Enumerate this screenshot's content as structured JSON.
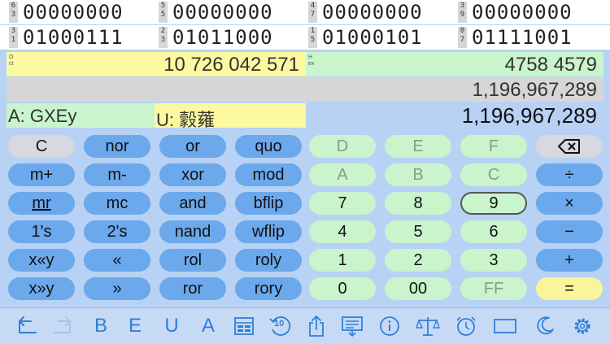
{
  "bit_rows": [
    {
      "groups": [
        {
          "label_top": "6",
          "label_bottom": "3",
          "bits": "00000000"
        },
        {
          "label_top": "5",
          "label_bottom": "5",
          "bits": "00000000"
        },
        {
          "label_top": "4",
          "label_bottom": "7",
          "bits": "00000000"
        },
        {
          "label_top": "3",
          "label_bottom": "9",
          "bits": "00000000"
        }
      ]
    },
    {
      "groups": [
        {
          "label_top": "3",
          "label_bottom": "1",
          "bits": "01000111"
        },
        {
          "label_top": "2",
          "label_bottom": "3",
          "bits": "01011000"
        },
        {
          "label_top": "1",
          "label_bottom": "5",
          "bits": "01000101"
        },
        {
          "label_top": "0",
          "label_bottom": "7",
          "bits": "01111001"
        }
      ]
    }
  ],
  "oct": {
    "tag": "Oct",
    "value": "10 726 042 571"
  },
  "hex": {
    "tag": "Hex",
    "value": "4758 4579"
  },
  "signed_decimal": "1,196,967,289",
  "ascii": "A: GXEy",
  "unicode": "U: 豰蕹",
  "decimal": "1,196,967,289",
  "keys": {
    "r1": [
      "C",
      "nor",
      "or",
      "quo",
      "D",
      "E",
      "F",
      "⌫"
    ],
    "r2": [
      "m+",
      "m-",
      "xor",
      "mod",
      "A",
      "B",
      "C",
      "÷"
    ],
    "r3": [
      "mr",
      "mc",
      "and",
      "bflip",
      "7",
      "8",
      "9",
      "×"
    ],
    "r4": [
      "1's",
      "2's",
      "nand",
      "wflip",
      "4",
      "5",
      "6",
      "−"
    ],
    "r5": [
      "x«y",
      "«",
      "rol",
      "roly",
      "1",
      "2",
      "3",
      "+"
    ],
    "r6": [
      "x»y",
      "»",
      "ror",
      "rory",
      "0",
      "00",
      "FF",
      "="
    ]
  },
  "toolbar": {
    "b_label": "B",
    "e_label": "E",
    "u_label": "U",
    "a_label": "A",
    "rotate_label": "10"
  },
  "colors": {
    "background": "#b7d2f4",
    "op_key": "#6ba8ec",
    "digit_key": "#c9f4cc",
    "equals_key": "#f9f59a",
    "accent": "#2f7fd8"
  }
}
